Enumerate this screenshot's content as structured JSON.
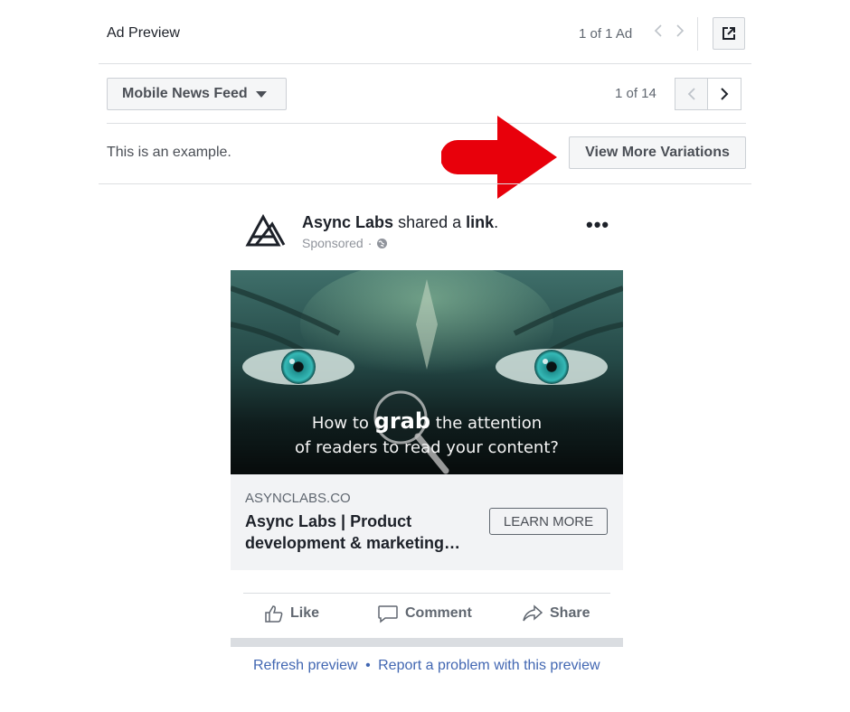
{
  "header": {
    "title": "Ad Preview",
    "ad_count": "1 of 1 Ad",
    "prev_icon": "chevron-left-icon",
    "next_icon": "chevron-right-icon",
    "external_icon": "open-external-icon"
  },
  "placement": {
    "selected": "Mobile News Feed",
    "count": "1 of 14"
  },
  "variations": {
    "example_text": "This is an example.",
    "button_label": "View More Variations",
    "arrow_color": "#e8000b"
  },
  "post": {
    "page_name": "Async Labs",
    "action_text": "shared a",
    "link_word": "link",
    "sponsored": "Sponsored",
    "more_icon": "more-options-icon",
    "more_glyph": "•••",
    "creative_line1_pre": "How to",
    "creative_line1_emph": "grab",
    "creative_line1_post": "the attention",
    "creative_line2": "of readers to read your content?",
    "domain": "ASYNCLABS.CO",
    "headline": "Async Labs | Product development & marketing…",
    "cta": "LEARN MORE"
  },
  "actions": {
    "like": "Like",
    "comment": "Comment",
    "share": "Share"
  },
  "footer": {
    "refresh": "Refresh preview",
    "separator": "•",
    "report": "Report a problem with this preview"
  }
}
